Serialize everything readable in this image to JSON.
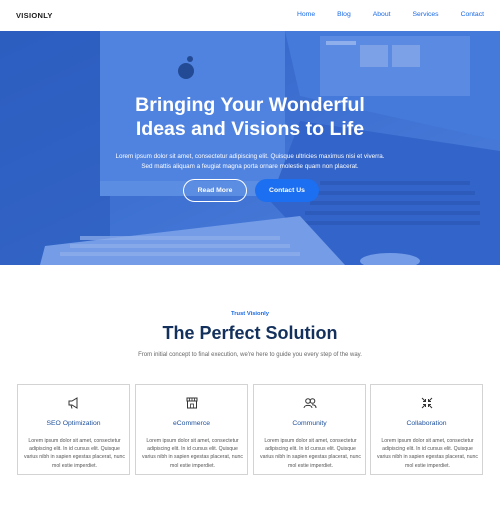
{
  "nav": {
    "brand": "VISIONLY",
    "links": [
      "Home",
      "Blog",
      "About",
      "Services",
      "Contact"
    ]
  },
  "hero": {
    "title_line1": "Bringing Your Wonderful",
    "title_line2": "Ideas and Visions to Life",
    "sub_line1": "Lorem ipsum dolor sit amet, consectetur adipiscing elit. Quisque ultricies maximus nisi et viverra.",
    "sub_line2": "Sed mattis aliquam a feugiat magna porta ornare molestie quam non placerat.",
    "btn_read_more": "Read More",
    "btn_contact": "Contact Us"
  },
  "section": {
    "kicker": "Trust Visionly",
    "title": "The Perfect Solution",
    "subtitle": "From initial concept to final execution, we're here to guide you every step of the way."
  },
  "cards": [
    {
      "icon": "megaphone-icon",
      "title": "SEO Optimization",
      "text": "Lorem ipsum dolor sit amet, consectetur adipiscing elit. In id cursus elit. Quisque varius nibh in sapien egestas placerat, nunc mol estie imperdiet."
    },
    {
      "icon": "store-icon",
      "title": "eCommerce",
      "text": "Lorem ipsum dolor sit amet, consectetur adipiscing elit. In id cursus elit. Quisque varius nibh in sapien egestas placerat, nunc mol estie imperdiet."
    },
    {
      "icon": "users-icon",
      "title": "Community",
      "text": "Lorem ipsum dolor sit amet, consectetur adipiscing elit. In id cursus elit. Quisque varius nibh in sapien egestas placerat, nunc mol estie imperdiet."
    },
    {
      "icon": "collapse-arrows-icon",
      "title": "Collaboration",
      "text": "Lorem ipsum dolor sit amet, consectetur adipiscing elit. In id cursus elit. Quisque varius nibh in sapien egestas placerat, nunc mol estie imperdiet."
    }
  ],
  "colors": {
    "accent": "#1769e6",
    "heading": "#13315c",
    "hero_overlay": "#3f74d6"
  }
}
